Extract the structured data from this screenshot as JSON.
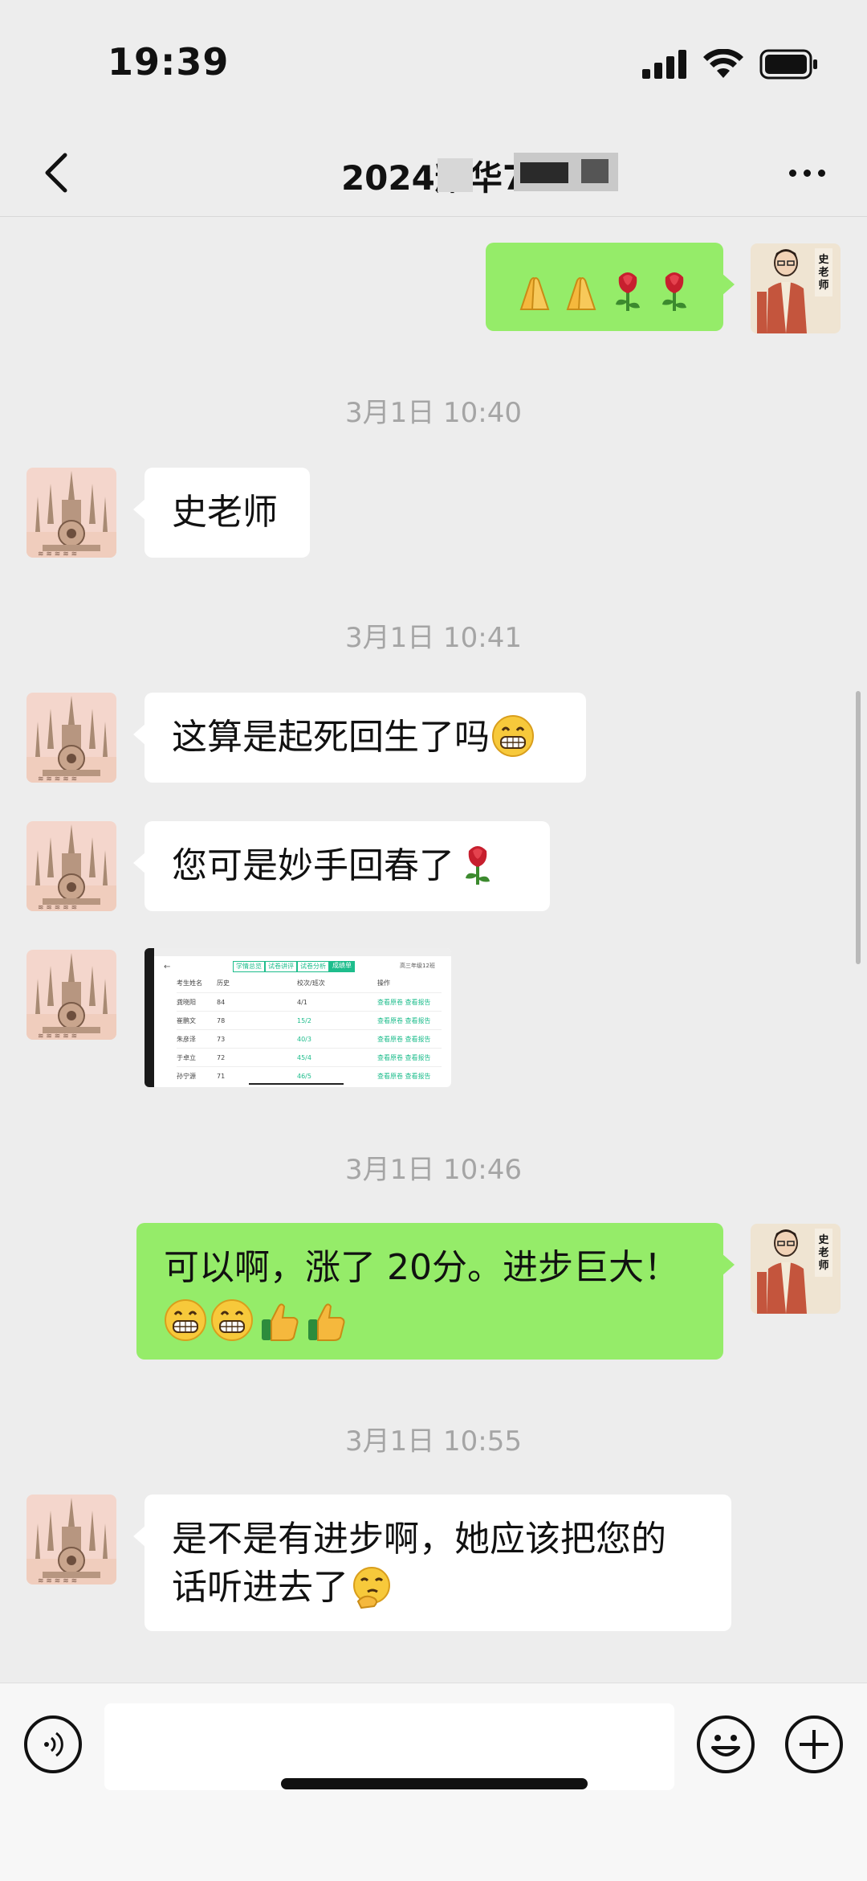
{
  "status_bar": {
    "time": "19:39"
  },
  "header": {
    "title": "2024耀华7"
  },
  "messages": [
    {
      "timestamp": "3月1日 10:40"
    },
    {
      "text": "史老师"
    },
    {
      "timestamp": "3月1日 10:41"
    },
    {
      "text": "这算是起死回生了吗"
    },
    {
      "text": "您可是妙手回春了"
    },
    {
      "timestamp": "3月1日 10:46"
    },
    {
      "text_line1": "可以啊，涨了 20分。进步巨大！"
    },
    {
      "timestamp": "3月1日 10:55"
    },
    {
      "text_line1": "是不是有进步啊，她应该把您的",
      "text_line2": "话听进去了"
    }
  ],
  "screenshot_thumb": {
    "tabs": [
      "学情总览",
      "试卷讲评",
      "试卷分析",
      "成绩单"
    ],
    "dropdown": "高三年级12班",
    "headers": [
      "考生姓名",
      "历史",
      "校次/班次",
      "操作"
    ],
    "rows": [
      {
        "name": "龚晓阳",
        "score": "84",
        "rank": "4/1",
        "action": "查看原卷  查看报告"
      },
      {
        "name": "崔鹏文",
        "score": "78",
        "rank": "15/2",
        "action": "查看原卷  查看报告"
      },
      {
        "name": "朱彦泽",
        "score": "73",
        "rank": "40/3",
        "action": "查看原卷  查看报告"
      },
      {
        "name": "于卓立",
        "score": "72",
        "rank": "45/4",
        "action": "查看原卷  查看报告"
      },
      {
        "name": "孙宁源",
        "score": "71",
        "rank": "46/5",
        "action": "查看原卷  查看报告"
      }
    ]
  },
  "icons": {
    "back": "chevron-left-icon",
    "more": "more-dots-icon",
    "voice": "voice-icon",
    "emoji": "smile-icon",
    "plus": "plus-icon"
  },
  "colors": {
    "outgoing_bubble": "#95ec69",
    "incoming_bubble": "#ffffff",
    "background": "#ededed",
    "table_accent": "#1ebd8c"
  }
}
